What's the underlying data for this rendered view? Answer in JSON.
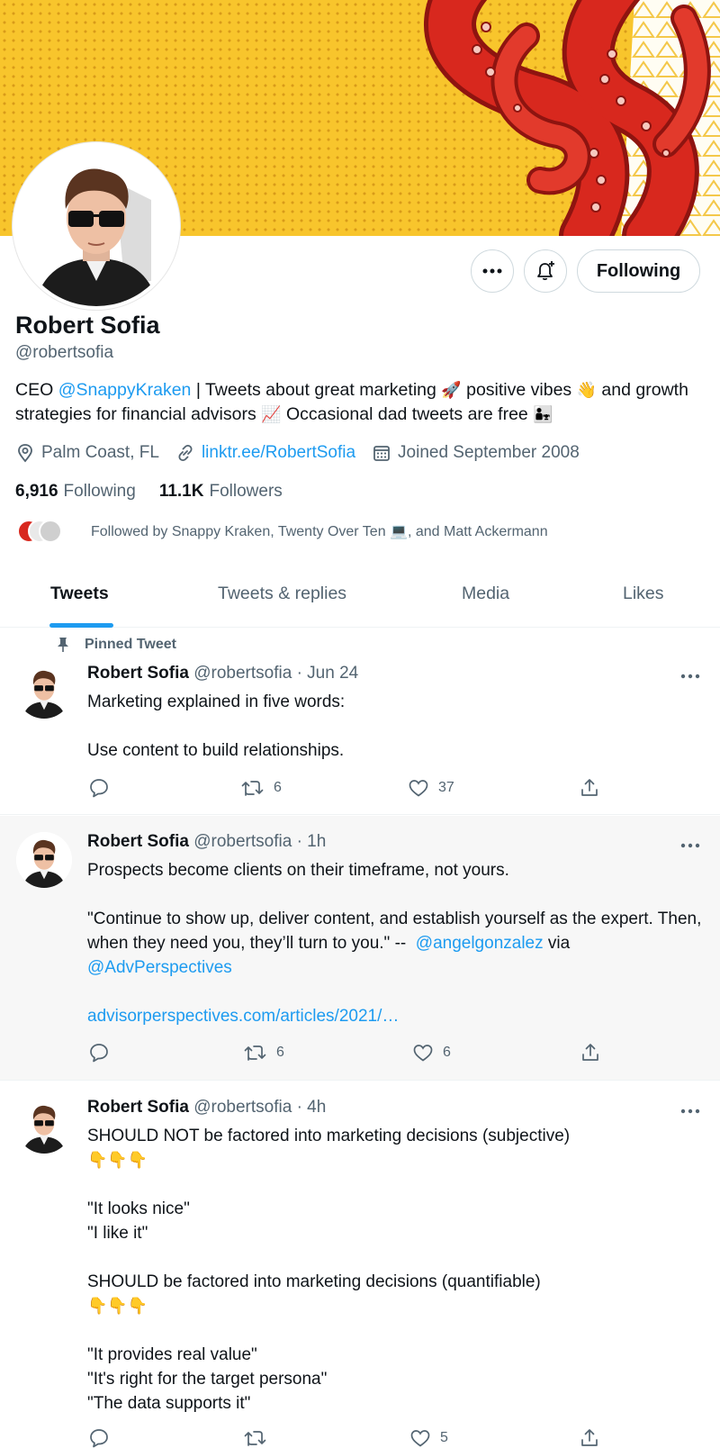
{
  "profile": {
    "name": "Robert Sofia",
    "handle": "@robertsofia",
    "bio": {
      "p1": "CEO ",
      "mention": "@SnappyKraken",
      "p2": " | Tweets about great marketing ",
      "e1": "🚀",
      "p3": " positive vibes ",
      "e2": "👋",
      "p4": " and growth strategies for financial advisors ",
      "e3": "📈",
      "p5": " Occasional dad tweets are free ",
      "e4": "👨‍👧"
    },
    "location": "Palm Coast, FL",
    "website": "linktr.ee/RobertSofia",
    "joined": "Joined September 2008",
    "following_count": "6,916",
    "following_label": "Following",
    "followers_count": "11.1K",
    "followers_label": "Followers",
    "followed_by": "Followed by Snappy Kraken, Twenty Over Ten 💻, and Matt Ackermann"
  },
  "actions": {
    "follow_label": "Following",
    "more_icon": "more-icon",
    "bell_icon": "bell-plus-icon"
  },
  "tabs": [
    {
      "label": "Tweets",
      "active": true
    },
    {
      "label": "Tweets & replies",
      "active": false
    },
    {
      "label": "Media",
      "active": false
    },
    {
      "label": "Likes",
      "active": false
    }
  ],
  "tweets": [
    {
      "pinned_label": "Pinned Tweet",
      "name": "Robert Sofia",
      "sub": "@robertsofia · Jun 24",
      "text1": "Marketing explained in five words:\n\nUse content to build relationships.",
      "replies": "",
      "retweets": "6",
      "likes": "37"
    },
    {
      "name": "Robert Sofia",
      "sub": "@robertsofia · 1h",
      "text1": "Prospects become clients on their timeframe, not yours.\n\n\"Continue to show up, deliver content, and establish yourself as the expert. Then, when they need you, they’ll turn to you.\" --  ",
      "mention1": "@angelgonzalez",
      "text2": " via\n",
      "mention2": "@AdvPerspectives",
      "text3": "\n\n",
      "link": "advisorperspectives.com/articles/2021/…",
      "replies": "",
      "retweets": "6",
      "likes": "6"
    },
    {
      "name": "Robert Sofia",
      "sub": "@robertsofia · 4h",
      "line1": "SHOULD NOT be factored into marketing decisions (subjective)",
      "emojis1": "👇👇👇",
      "block1": "\"It looks nice\"\n\"I like it\"",
      "line2": "SHOULD be factored into marketing decisions (quantifiable)",
      "emojis2": "👇👇👇",
      "block2": "\"It provides real value\"\n\"It's right for the target persona\"\n\"The data supports it\"",
      "replies": "",
      "retweets": "",
      "likes": "5"
    }
  ],
  "colors": {
    "accent": "#1d9bf0",
    "banner_yellow": "#f8c52c",
    "tentacle_red": "#d8281e",
    "secondary_text": "#536471"
  }
}
